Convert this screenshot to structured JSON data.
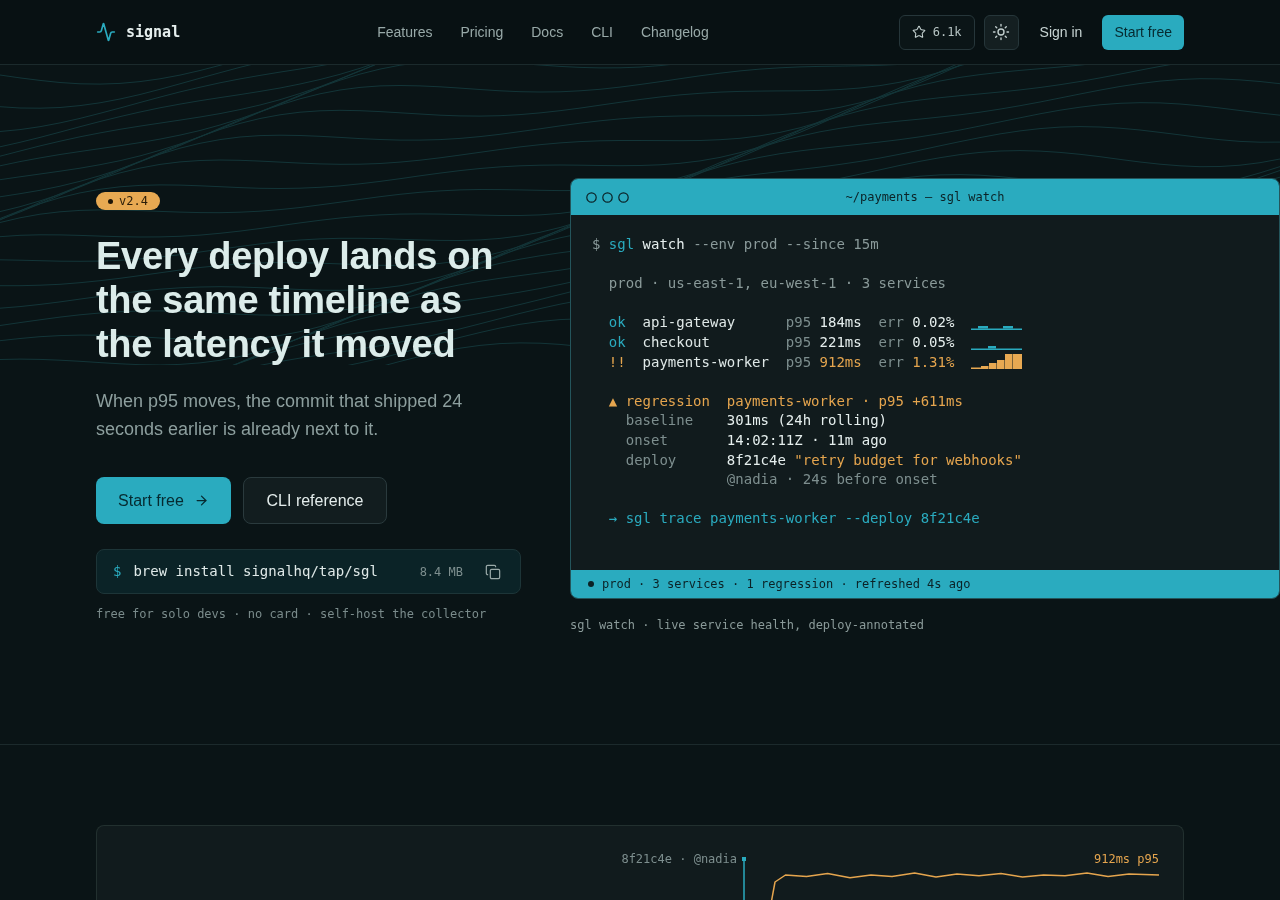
{
  "header": {
    "logo": "signal",
    "nav": [
      "Features",
      "Pricing",
      "Docs",
      "CLI",
      "Changelog"
    ],
    "stars": "6.1k",
    "sign_in": "Sign in",
    "cta": "Start free"
  },
  "hero": {
    "badge": "v2.4",
    "headline": "Every deploy lands on the same timeline as the latency it moved",
    "subtitle": "When p95 moves, the commit that shipped 24 seconds earlier is already next to it.",
    "buttons": [
      {
        "label": "Start free",
        "kind": "primary"
      },
      {
        "label": "CLI reference",
        "kind": "secondary"
      }
    ],
    "install": {
      "prompt": "$",
      "command": "brew install signalhq/tap/sgl",
      "size": "8.4 MB"
    },
    "footnote": "free for solo devs · no card · self-host the collector"
  },
  "terminal": {
    "title": "~/payments — sgl watch",
    "command": {
      "prompt": "$",
      "tool": "sgl",
      "subcommand": "watch",
      "args": "--env prod --since 15m"
    },
    "context": "prod · us-east-1, eu-west-1 · 3 services",
    "services": [
      {
        "status": "ok",
        "name": "api-gateway",
        "p95_label": "p95",
        "p95": "184ms",
        "err_label": "err",
        "err": "0.02%",
        "alert": false
      },
      {
        "status": "ok",
        "name": "checkout",
        "p95_label": "p95",
        "p95": "221ms",
        "err_label": "err",
        "err": "0.05%",
        "alert": false
      },
      {
        "status": "!!",
        "name": "payments-worker",
        "p95_label": "p95",
        "p95": "912ms",
        "err_label": "err",
        "err": "1.31%",
        "alert": true
      }
    ],
    "regression": {
      "marker": "▲",
      "label": "regression",
      "summary": "payments-worker · p95 +611ms",
      "details": [
        {
          "label": "baseline",
          "value": "301ms (24h rolling)"
        },
        {
          "label": "onset",
          "value": "14:02:11Z · 11m ago"
        },
        {
          "label": "deploy",
          "value": "8f21c4e",
          "message": "\"retry budget for webhooks\"",
          "note": "@nadia · 24s before onset"
        }
      ]
    },
    "hint": {
      "arrow": "→",
      "command": "sgl trace payments-worker --deploy 8f21c4e"
    },
    "status_bar": "prod · 3 services · 1 regression · refreshed 4s ago"
  },
  "terminal_caption": "sgl watch · live service health, deploy-annotated",
  "timeline": {
    "deploy_label": "8f21c4e · @nadia",
    "latency_label": "912ms p95"
  }
}
